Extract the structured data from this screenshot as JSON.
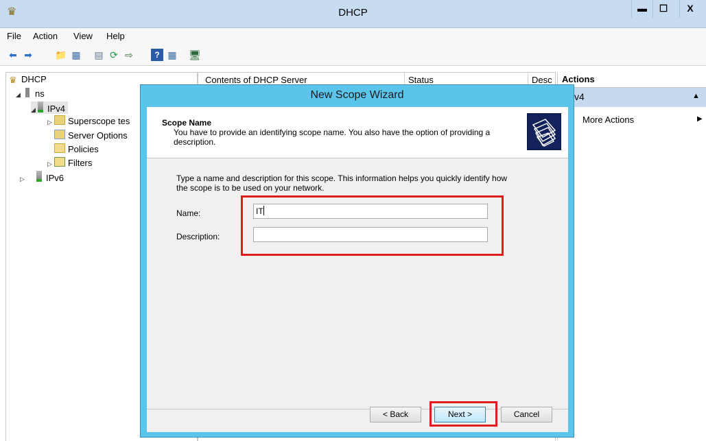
{
  "window": {
    "title": "DHCP",
    "min": "▬",
    "max": "☐",
    "close": "X"
  },
  "menu": [
    "File",
    "Action",
    "View",
    "Help"
  ],
  "tree": {
    "root": "DHCP",
    "server": "ns",
    "ipv4": "IPv4",
    "superscope": "Superscope tes",
    "server_options": "Server Options",
    "policies": "Policies",
    "filters": "Filters",
    "ipv6": "IPv6"
  },
  "content": {
    "col1": "Contents of DHCP Server",
    "col2": "Status",
    "col3": "Desc"
  },
  "actions": {
    "header": "Actions",
    "selected": "v4",
    "more": "More Actions"
  },
  "wizard": {
    "title": "New Scope Wizard",
    "section_title": "Scope Name",
    "section_desc": "You have to provide an identifying scope name. You also have the option of providing a description.",
    "intro": "Type a name and description for this scope. This information helps you quickly identify how the scope is to be used on your network.",
    "name_label": "Name:",
    "name_value": "IT",
    "description_label": "Description:",
    "description_value": "",
    "back": "< Back",
    "next": "Next >",
    "cancel": "Cancel"
  },
  "colors": {
    "dialog_frame": "#5bc4eb",
    "highlight": "#e01b1b",
    "titlebar": "#c7dcf0"
  }
}
